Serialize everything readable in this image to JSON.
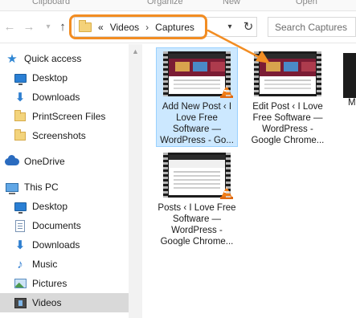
{
  "ribbon": {
    "labels": [
      "Clipboard",
      "Organize",
      "New",
      "Open"
    ]
  },
  "address": {
    "prefix": "«",
    "crumbs": [
      "Videos",
      "Captures"
    ],
    "separator": "›"
  },
  "search": {
    "placeholder": "Search Captures"
  },
  "sidebar": {
    "items": [
      {
        "label": "Quick access",
        "icon": "star-icon"
      },
      {
        "label": "Desktop",
        "icon": "desktop-icon"
      },
      {
        "label": "Downloads",
        "icon": "download-icon"
      },
      {
        "label": "PrintScreen Files",
        "icon": "folder-icon"
      },
      {
        "label": "Screenshots",
        "icon": "folder-icon"
      },
      {
        "label": "OneDrive",
        "icon": "cloud-icon"
      },
      {
        "label": "This PC",
        "icon": "computer-icon"
      },
      {
        "label": "Desktop",
        "icon": "desktop-icon"
      },
      {
        "label": "Documents",
        "icon": "documents-icon"
      },
      {
        "label": "Downloads",
        "icon": "download-icon"
      },
      {
        "label": "Music",
        "icon": "music-icon"
      },
      {
        "label": "Pictures",
        "icon": "pictures-icon"
      },
      {
        "label": "Videos",
        "icon": "videos-icon"
      }
    ],
    "selected": "Videos"
  },
  "files": [
    {
      "name": "Add New Post ‹ I Love Free Software — WordPress - Go...",
      "icon": "vlc-icon"
    },
    {
      "name": "Edit Post ‹ I Love Free Software — WordPress - Google Chrome...",
      "icon": "video-thumbnail"
    },
    {
      "name": "Posts ‹ I Love Free Software — WordPress - Google Chrome...",
      "icon": "vlc-icon"
    }
  ],
  "partial_file": {
    "label": "M"
  },
  "colors": {
    "highlight": "#f28d23",
    "selection": "#cce8ff",
    "sidebar_selected": "#d9d9d9"
  }
}
